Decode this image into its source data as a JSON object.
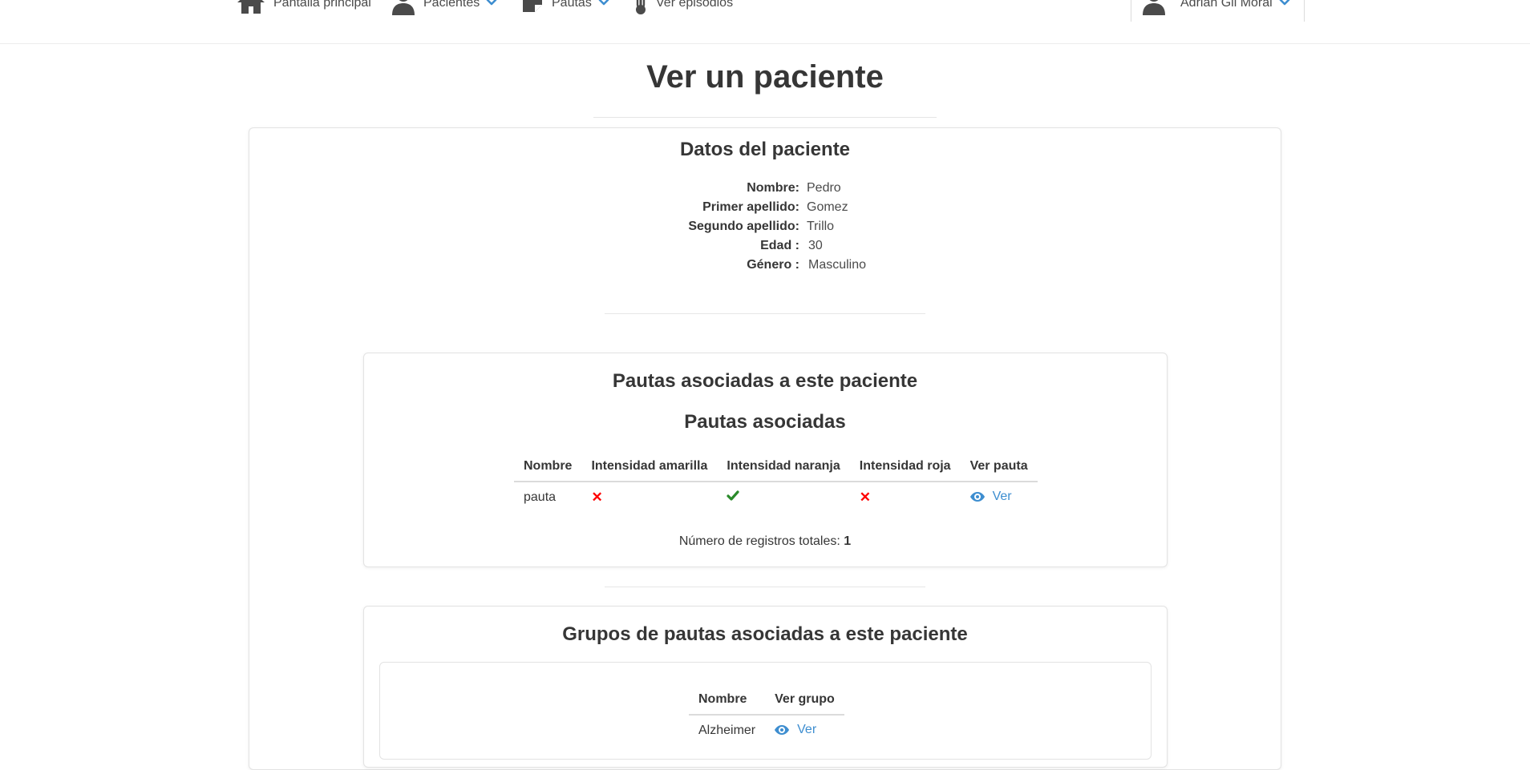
{
  "nav": {
    "home": "Pantalla principal",
    "patients": "Pacientes",
    "guidelines": "Pautas",
    "episodes": "Ver episodios",
    "user": "Adrian Gil Moral"
  },
  "page": {
    "title": "Ver un paciente"
  },
  "patient": {
    "heading": "Datos del paciente",
    "fields": [
      {
        "label": "Nombre:",
        "value": "Pedro"
      },
      {
        "label": "Primer apellido:",
        "value": "Gomez"
      },
      {
        "label": "Segundo apellido:",
        "value": "Trillo"
      },
      {
        "label": "Edad :",
        "value": "30"
      },
      {
        "label": "Género :",
        "value": "Masculino"
      }
    ]
  },
  "guidelines_card": {
    "heading": "Pautas asociadas a este paciente",
    "subheading": "Pautas asociadas",
    "columns": [
      "Nombre",
      "Intensidad amarilla",
      "Intensidad naranja",
      "Intensidad roja",
      "Ver pauta"
    ],
    "rows": [
      {
        "name": "pauta",
        "yellow": false,
        "orange": true,
        "red": false,
        "link": "Ver"
      }
    ],
    "total_label": "Número de registros totales:",
    "total_value": "1"
  },
  "groups_card": {
    "heading": "Grupos de pautas asociadas a este paciente",
    "columns": [
      "Nombre",
      "Ver grupo"
    ],
    "rows": [
      {
        "name": "Alzheimer",
        "link": "Ver"
      }
    ]
  },
  "icons": {
    "yes": "check-icon",
    "no": "x-mark-icon",
    "view": "eye-icon"
  },
  "colors": {
    "link": "#3e8ed0",
    "yes": "#2a8a2a",
    "no": "#ff0000",
    "text": "#363636"
  }
}
